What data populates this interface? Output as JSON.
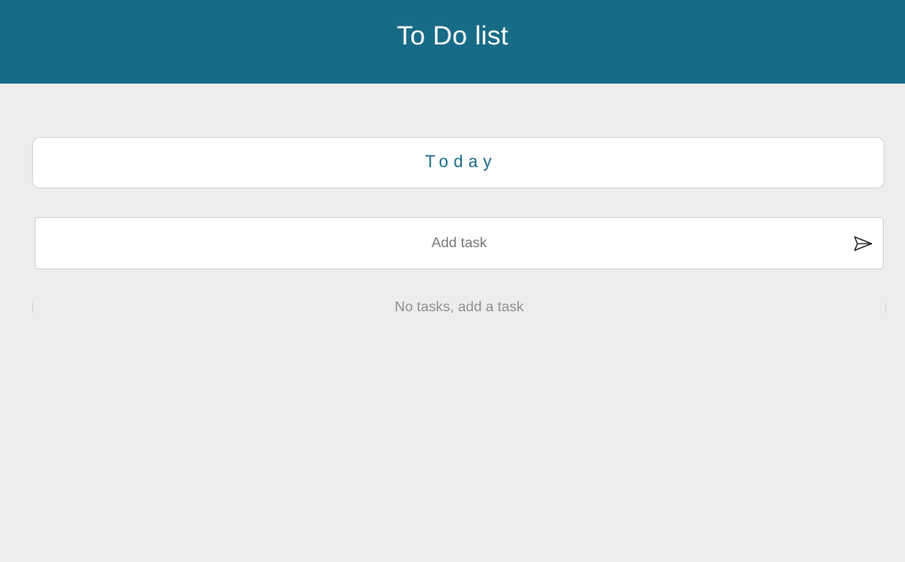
{
  "header": {
    "title": "To Do list"
  },
  "day_selector": {
    "label": "Today"
  },
  "add_task": {
    "placeholder": "Add task",
    "value": "",
    "submit_icon": "send-icon"
  },
  "task_list": {
    "empty_message": "No tasks, add a task",
    "items": []
  },
  "colors": {
    "header_background": "#186b87",
    "accent_text": "#186b87",
    "page_background": "#ededed",
    "card_background": "#ffffff"
  }
}
